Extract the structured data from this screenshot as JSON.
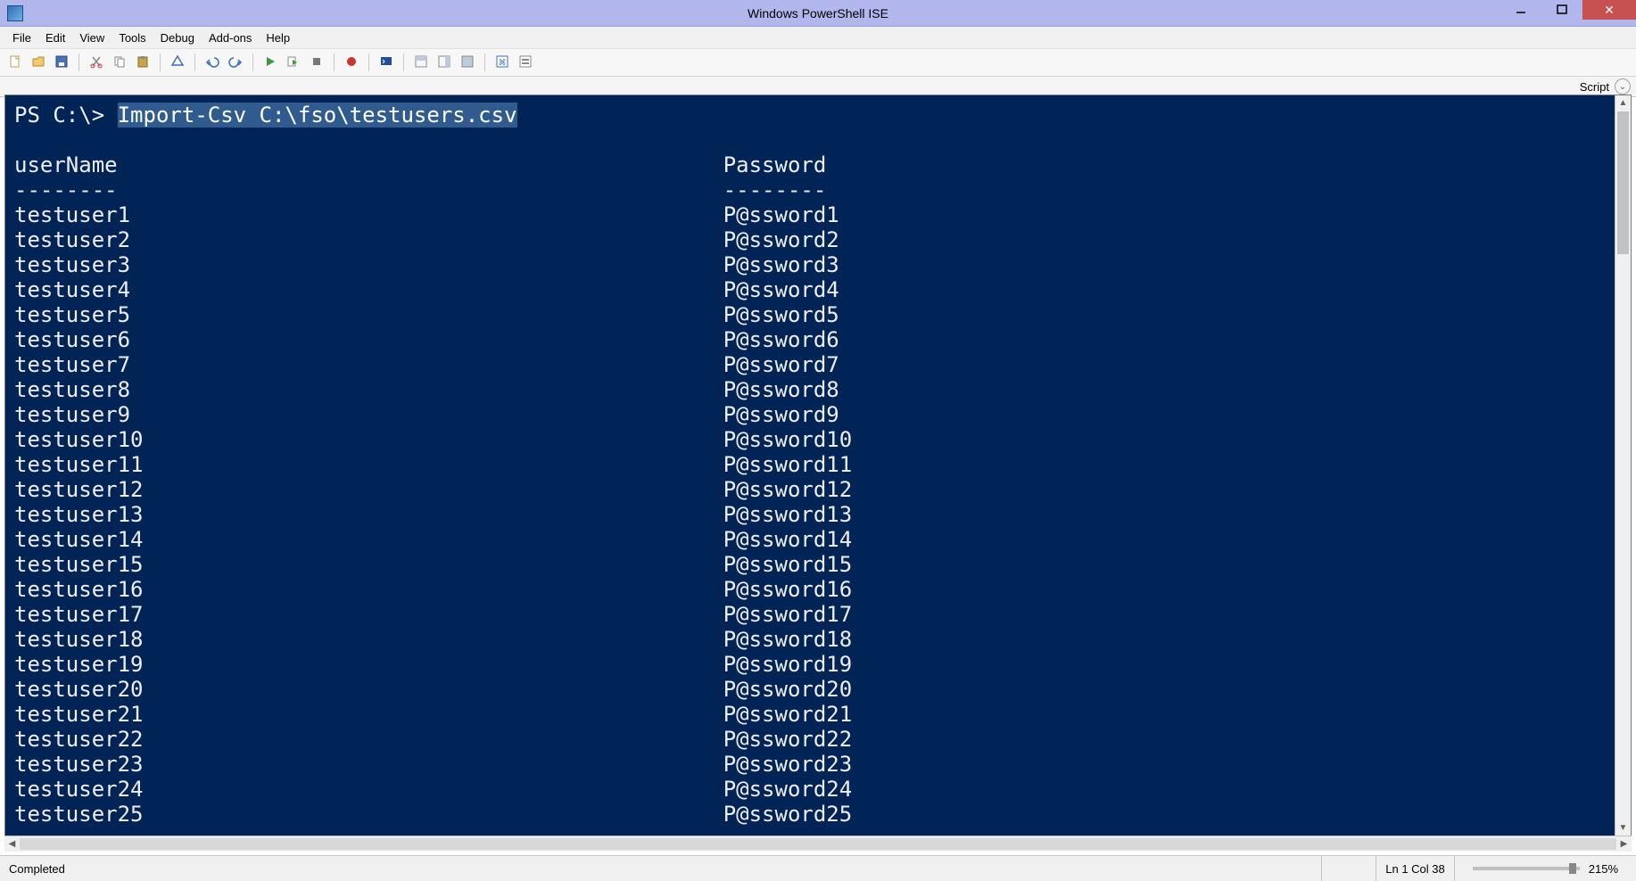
{
  "window": {
    "title": "Windows PowerShell ISE"
  },
  "menu": {
    "items": [
      "File",
      "Edit",
      "View",
      "Tools",
      "Debug",
      "Add-ons",
      "Help"
    ]
  },
  "toolbar": {
    "icons": [
      "new-file-icon",
      "open-file-icon",
      "save-icon",
      "sep",
      "cut-icon",
      "copy-icon",
      "paste-icon",
      "sep",
      "clear-icon",
      "sep",
      "undo-icon",
      "redo-icon",
      "sep",
      "run-icon",
      "run-selection-icon",
      "stop-icon",
      "sep",
      "breakpoint-icon",
      "sep",
      "remote-icon",
      "sep",
      "show-script-top-icon",
      "show-script-right-icon",
      "show-script-max-icon",
      "sep",
      "command-addon-icon",
      "options-icon"
    ]
  },
  "scriptRow": {
    "label": "Script"
  },
  "console": {
    "prompt": "PS C:\\>",
    "command": "Import-Csv C:\\fso\\testusers.csv",
    "headers": {
      "col1": "userName",
      "col2": "Password"
    },
    "divider": "--------",
    "rows": [
      {
        "u": "testuser1",
        "p": "P@ssword1"
      },
      {
        "u": "testuser2",
        "p": "P@ssword2"
      },
      {
        "u": "testuser3",
        "p": "P@ssword3"
      },
      {
        "u": "testuser4",
        "p": "P@ssword4"
      },
      {
        "u": "testuser5",
        "p": "P@ssword5"
      },
      {
        "u": "testuser6",
        "p": "P@ssword6"
      },
      {
        "u": "testuser7",
        "p": "P@ssword7"
      },
      {
        "u": "testuser8",
        "p": "P@ssword8"
      },
      {
        "u": "testuser9",
        "p": "P@ssword9"
      },
      {
        "u": "testuser10",
        "p": "P@ssword10"
      },
      {
        "u": "testuser11",
        "p": "P@ssword11"
      },
      {
        "u": "testuser12",
        "p": "P@ssword12"
      },
      {
        "u": "testuser13",
        "p": "P@ssword13"
      },
      {
        "u": "testuser14",
        "p": "P@ssword14"
      },
      {
        "u": "testuser15",
        "p": "P@ssword15"
      },
      {
        "u": "testuser16",
        "p": "P@ssword16"
      },
      {
        "u": "testuser17",
        "p": "P@ssword17"
      },
      {
        "u": "testuser18",
        "p": "P@ssword18"
      },
      {
        "u": "testuser19",
        "p": "P@ssword19"
      },
      {
        "u": "testuser20",
        "p": "P@ssword20"
      },
      {
        "u": "testuser21",
        "p": "P@ssword21"
      },
      {
        "u": "testuser22",
        "p": "P@ssword22"
      },
      {
        "u": "testuser23",
        "p": "P@ssword23"
      },
      {
        "u": "testuser24",
        "p": "P@ssword24"
      },
      {
        "u": "testuser25",
        "p": "P@ssword25"
      }
    ]
  },
  "status": {
    "left": "Completed",
    "position": "Ln 1  Col 38",
    "zoom": "215%"
  }
}
